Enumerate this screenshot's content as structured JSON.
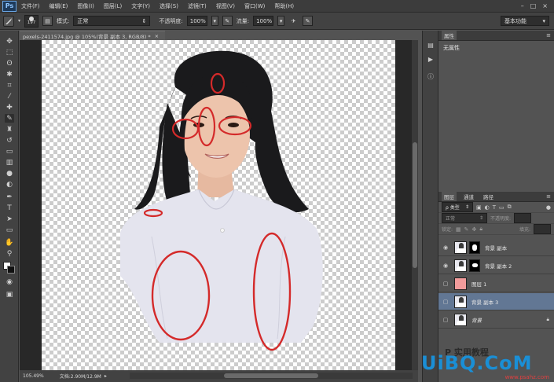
{
  "app": {
    "logo": "Ps"
  },
  "menu": [
    "文件(F)",
    "编辑(E)",
    "图像(I)",
    "图层(L)",
    "文字(Y)",
    "选择(S)",
    "滤镜(T)",
    "视图(V)",
    "窗口(W)",
    "帮助(H)"
  ],
  "window_controls": [
    "–",
    "□",
    "×"
  ],
  "options": {
    "brush_size": "197",
    "mode_label": "模式:",
    "mode_value": "正常",
    "opacity_label": "不透明度:",
    "opacity_value": "100%",
    "flow_label": "流量:",
    "flow_value": "100%",
    "workspace": "基本功能"
  },
  "document": {
    "tab_title": "pexels-2411574.jpg @ 105%(背景 副本 3, RGB/8) *",
    "zoom": "105.49%",
    "doc_size": "文档:2.90M/12.9M"
  },
  "properties": {
    "tab": "属性",
    "body": "无属性"
  },
  "layers_panel": {
    "tabs": [
      "图层",
      "通道",
      "路径"
    ],
    "filter_kind": "ρ 类型",
    "blend_mode": "正常",
    "opacity_label": "不透明度:",
    "lock_label": "锁定:",
    "fill_label": "填充:",
    "layers": [
      {
        "name": "背景 副本",
        "visible": true,
        "mask": true,
        "selected": false
      },
      {
        "name": "背景 副本 2",
        "visible": true,
        "mask": true,
        "selected": false
      },
      {
        "name": "图层 1",
        "visible": false,
        "mask": false,
        "selected": false,
        "color": "#f29b9b"
      },
      {
        "name": "背景 副本 3",
        "visible": false,
        "mask": false,
        "selected": true
      },
      {
        "name": "背景",
        "visible": false,
        "mask": false,
        "selected": false,
        "locked": true
      }
    ]
  },
  "watermark": {
    "main": "UiBQ.CoM",
    "cn": "P 实用教程",
    "url": "www.psahz.com"
  },
  "colors": {
    "selected_layer": "#627794",
    "accent_circle": "#d42a2a",
    "watermark_blue": "#1a8fd6"
  }
}
